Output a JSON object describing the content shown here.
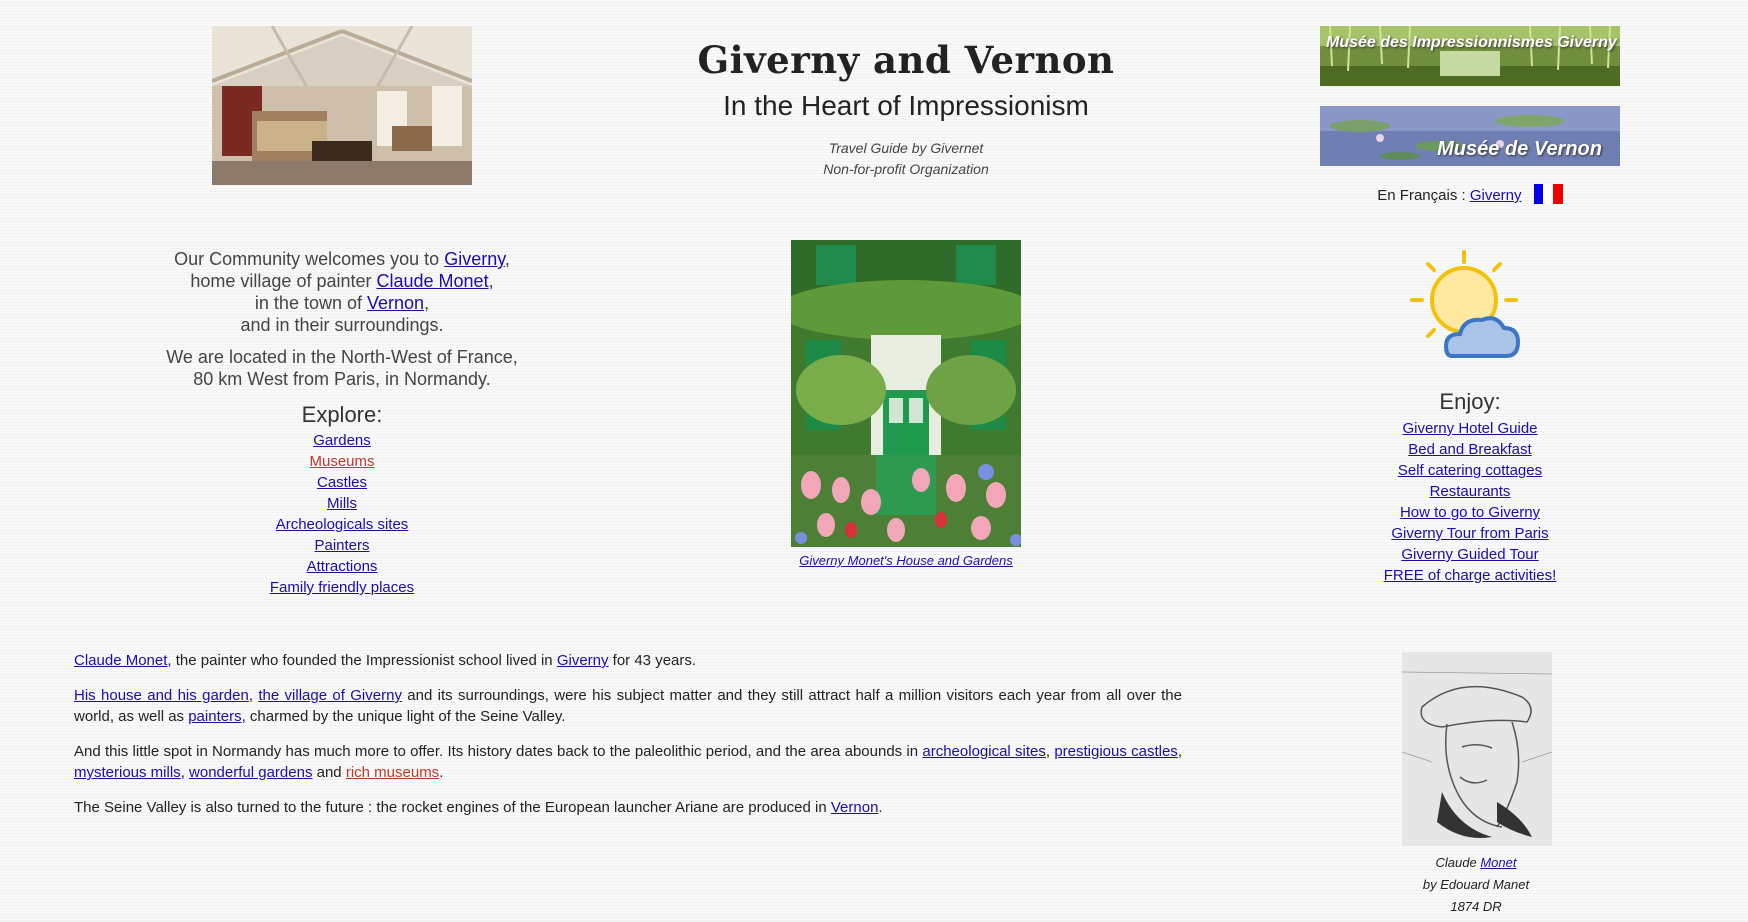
{
  "header": {
    "title": "Giverny and Vernon",
    "subtitle": "In the Heart of Impressionism",
    "tagline_line1": "Travel Guide by Givernet",
    "tagline_line2": "Non-for-profit Organization"
  },
  "banners": {
    "b1": "Musée des Impressionnismes Giverny",
    "b2": "Musée de Vernon"
  },
  "lang": {
    "label": "En Français : ",
    "link": "Giverny"
  },
  "welcome": {
    "l1_pre": "Our Community welcomes you to ",
    "l1_link": "Giverny",
    "l1_post": ",",
    "l2_pre": "home village of painter ",
    "l2_link": "Claude Monet",
    "l2_post": ",",
    "l3_pre": "in the town of ",
    "l3_link": "Vernon",
    "l3_post": ",",
    "l4": "and in their surroundings.",
    "loc1": "We are located in the North-West of France,",
    "loc2": "80 km West from Paris, in Normandy."
  },
  "explore": {
    "title": "Explore:",
    "items": [
      "Gardens",
      "Museums",
      "Castles",
      "Mills",
      "Archeologicals sites",
      "Painters",
      "Attractions",
      "Family friendly places"
    ]
  },
  "house_caption": "Giverny Monet's House and Gardens",
  "enjoy": {
    "title": "Enjoy:",
    "items": [
      "Giverny Hotel Guide",
      "Bed and Breakfast",
      "Self catering cottages",
      "Restaurants",
      "How to go to Giverny",
      "Giverny Tour from Paris",
      "Giverny Guided Tour",
      "FREE of charge activities!"
    ]
  },
  "body": {
    "p1_link1": "Claude Monet",
    "p1_text1": ", the painter who founded the Impressionist school lived in ",
    "p1_link2": "Giverny",
    "p1_text2": " for 43 years.",
    "p2_link1": "His house and his garden",
    "p2_sep": ", ",
    "p2_link2": "the village of Giverny",
    "p2_text1": " and its surroundings, were his subject matter and they still attract half a million visitors each year from all over the world, as well as ",
    "p2_link3": "painters,",
    "p2_text2": " charmed by the unique light of the Seine Valley.",
    "p3_text1": "And this little spot in Normandy has much more to offer. Its history dates back to the paleolithic period, and the area abounds in ",
    "p3_link1": "archeological sites",
    "p3_sep1": ", ",
    "p3_link2": "prestigious castles",
    "p3_sep2": ", ",
    "p3_link3": "mysterious mills",
    "p3_sep3": ", ",
    "p3_link4": "wonderful gardens",
    "p3_text2": " and ",
    "p3_link5": "rich museums",
    "p3_end": ".",
    "p4_text": "The Seine Valley is also turned to the future : the rocket engines of the European launcher Ariane are produced in ",
    "p4_link": "Vernon",
    "p4_end": "."
  },
  "portrait_caption": {
    "l1_pre": "Claude ",
    "l1_link": "Monet",
    "l2": "by Edouard Manet",
    "l3": "1874 DR"
  },
  "colors": {
    "link": "#1a0dab",
    "visited_link": "#c0392b",
    "flag_blue": "#0000ee",
    "flag_red": "#ee0000"
  }
}
